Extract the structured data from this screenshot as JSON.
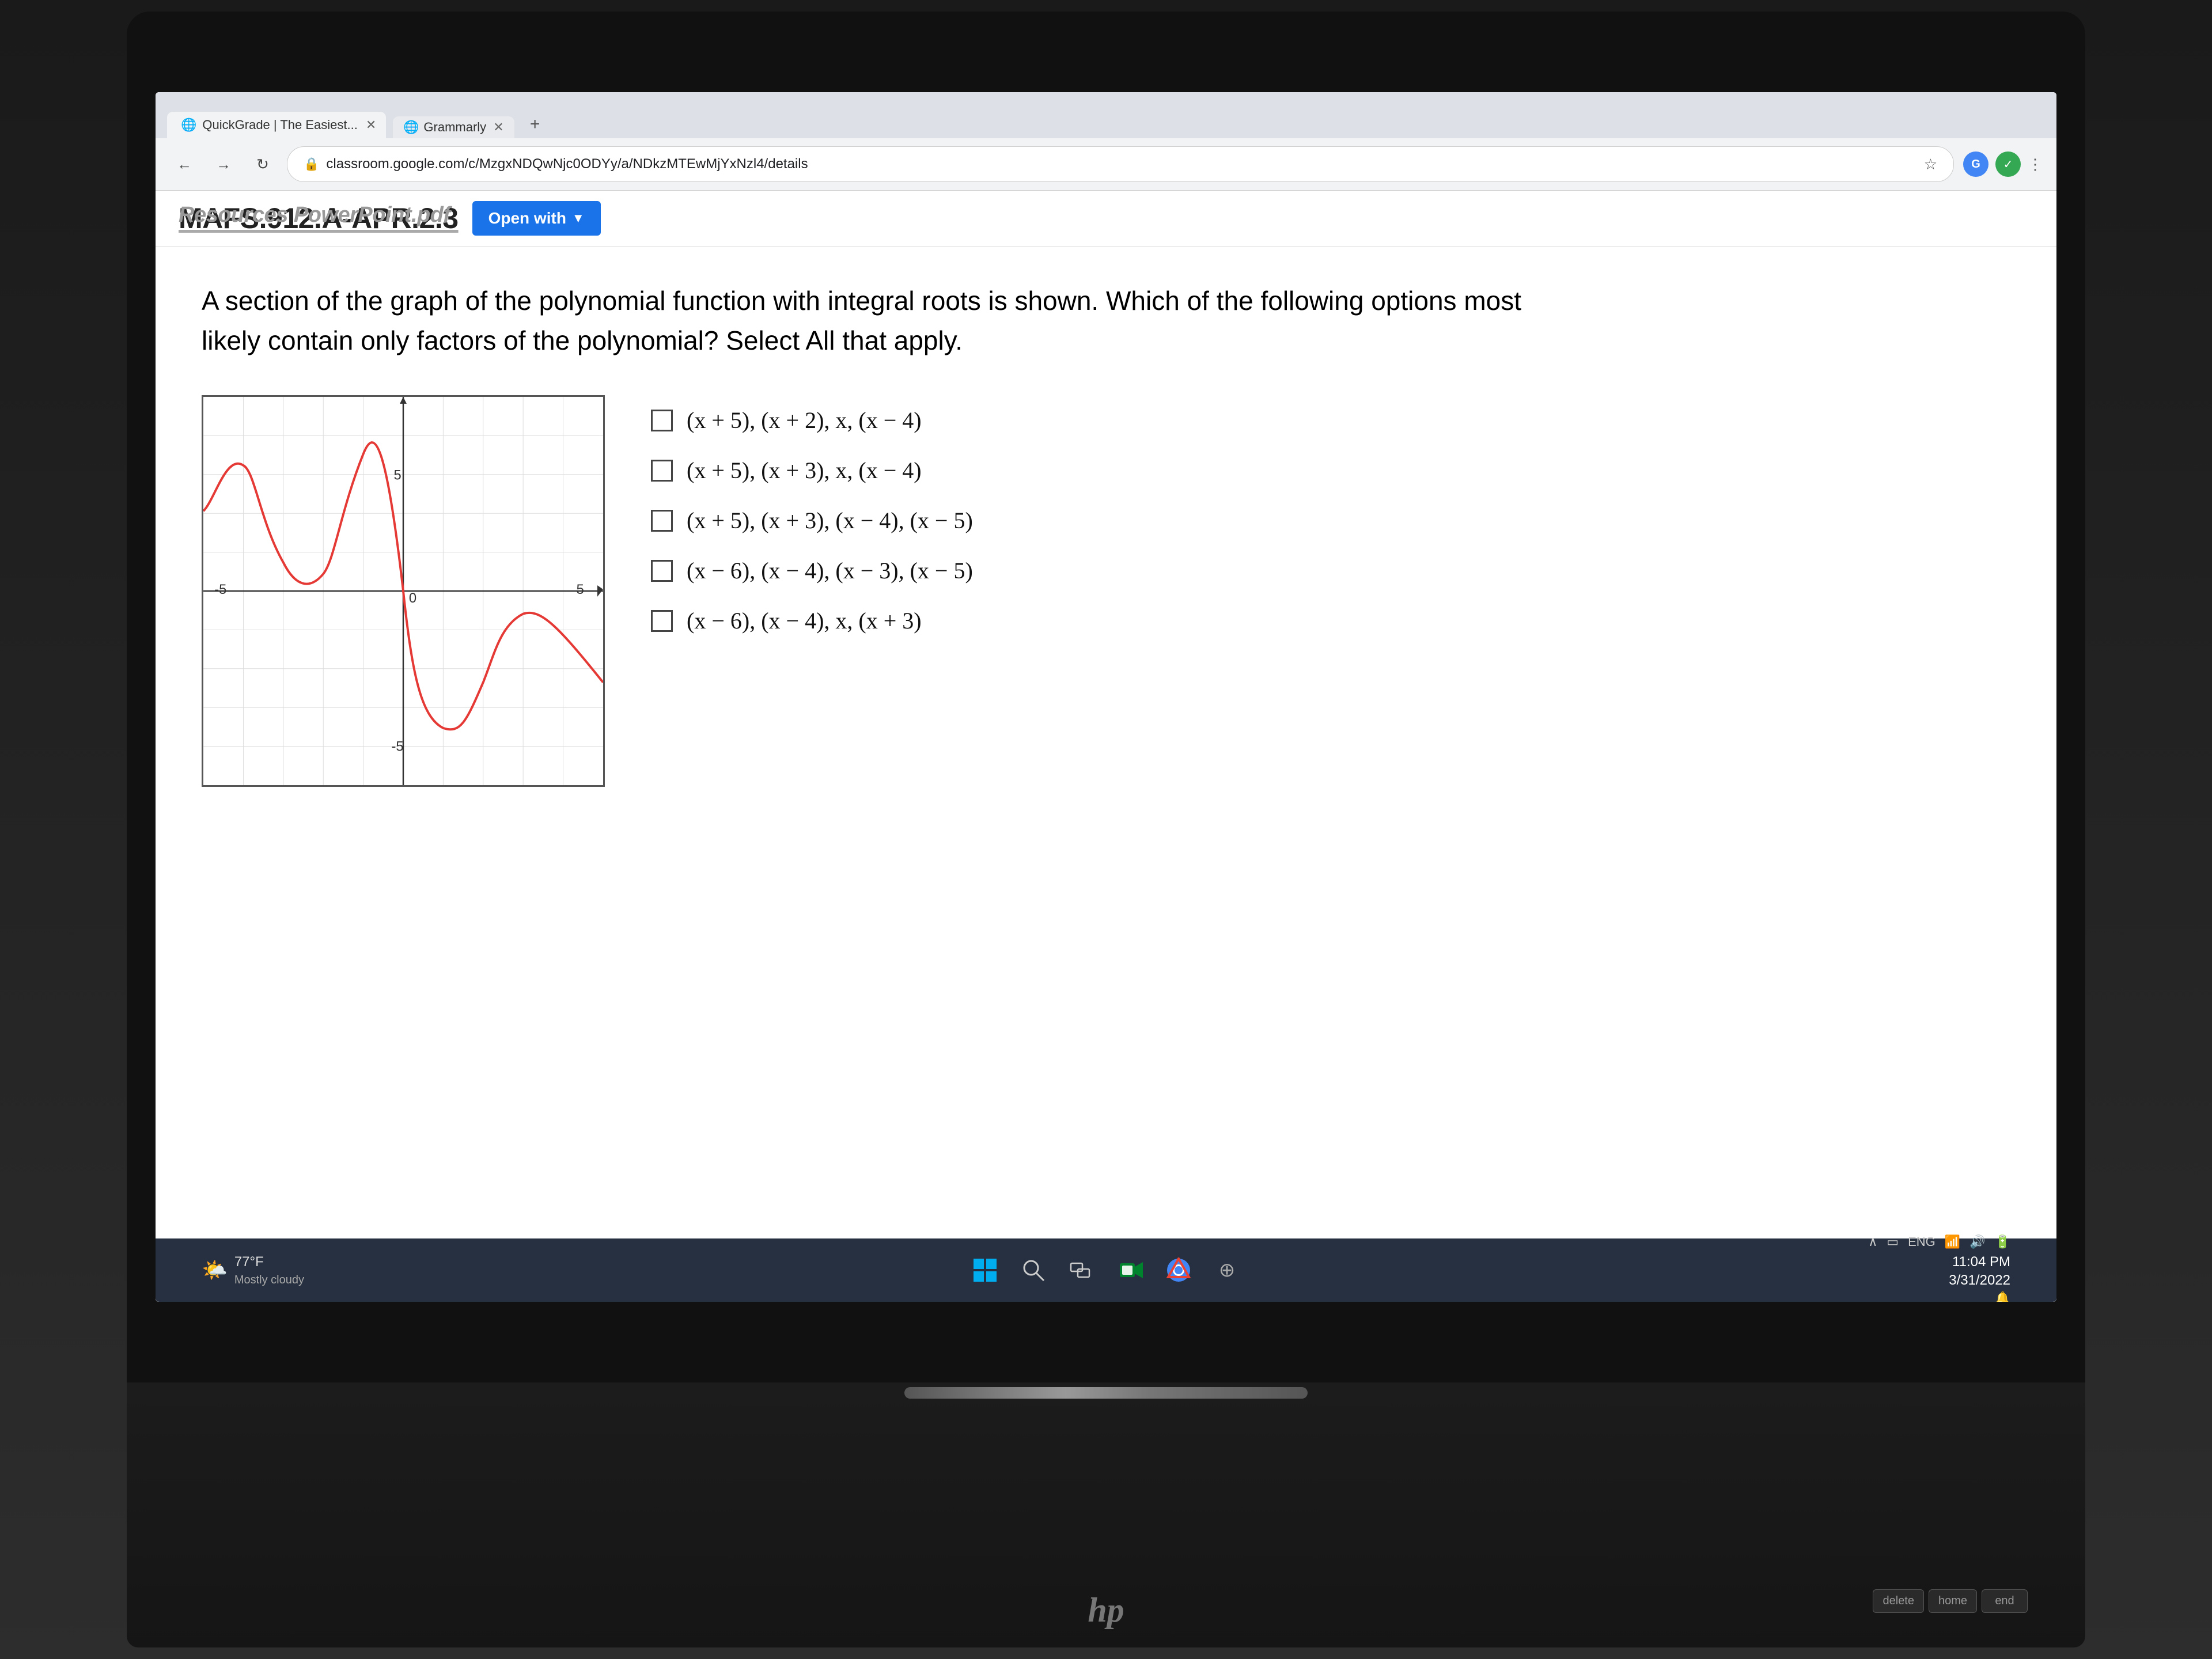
{
  "browser": {
    "url": "classroom.google.com/c/MzgxNDQwNjc0ODYy/a/NDkzMTEwMjYxNzl4/details",
    "tab_label": "QuickGrade | The Easiest...",
    "tab2_label": "Grammarly"
  },
  "classroom": {
    "breadcrumb": "MAFS.912.A-APR.2.3",
    "breadcrumb_overlay": "Resources PowerPoint.pdf",
    "open_with_label": "Open with"
  },
  "question": {
    "text": "A section of the graph of the polynomial function with integral roots is shown. Which of the following options most likely contain only factors of the polynomial? Select All that apply.",
    "choices": [
      {
        "id": "a",
        "text": "(x + 5), (x + 2), x, (x − 4)"
      },
      {
        "id": "b",
        "text": "(x + 5), (x + 3), x, (x − 4)"
      },
      {
        "id": "c",
        "text": "(x + 5), (x + 3), (x − 4), (x − 5)"
      },
      {
        "id": "d",
        "text": "(x − 6), (x − 4), (x − 3), (x − 5)"
      },
      {
        "id": "e",
        "text": "(x − 6), (x − 4), x, (x + 3)"
      }
    ]
  },
  "graph": {
    "x_min": -5,
    "x_max": 5,
    "y_min": -5,
    "y_max": 5,
    "label_x_neg": "-5",
    "label_x_pos": "5",
    "label_y_pos": "5",
    "label_y_neg": "-5",
    "label_origin": "0"
  },
  "taskbar": {
    "time": "11:04 PM",
    "date": "3/31/2022",
    "weather_temp": "77°F",
    "weather_desc": "Mostly cloudy",
    "lang": "ENG"
  },
  "keyboard": {
    "key1": "delete",
    "key2": "home",
    "key3": "end"
  }
}
